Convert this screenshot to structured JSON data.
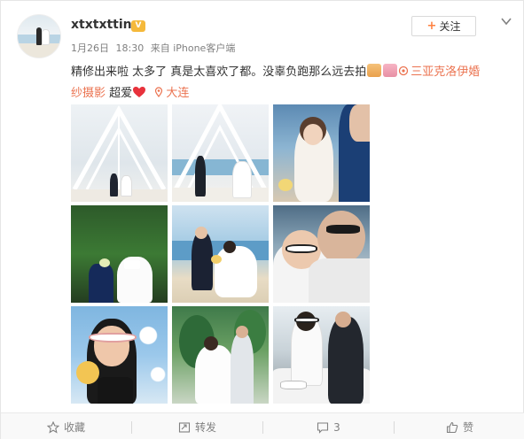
{
  "user": {
    "name": "xtxtxtting",
    "badge": "V"
  },
  "meta": {
    "date": "1月26日",
    "time": "18:30",
    "source": "来自 iPhone客户端"
  },
  "follow_label": "关注",
  "post": {
    "line1": "精修出来啦 太多了 真是太喜欢了都。没辜负跑那么远去拍",
    "link_text": "三亚克洛伊婚",
    "link_text2": "纱摄影",
    "after_link": " 超爱",
    "location": "大连"
  },
  "actions": {
    "favorite": "收藏",
    "repost": "转发",
    "comments": "3",
    "like": "赞"
  },
  "colors": {
    "accent": "#eb7350",
    "follow_plus": "#ff8140",
    "heart": "#e8323c"
  }
}
